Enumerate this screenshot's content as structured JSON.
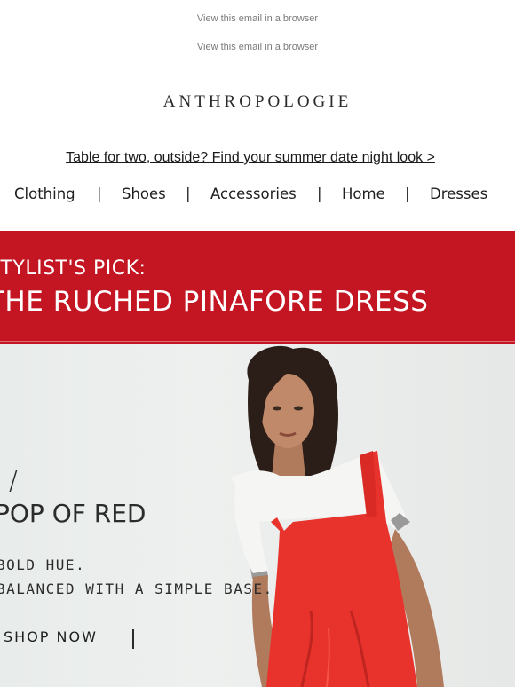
{
  "header": {
    "view_in_browser_1": "View this email in a browser",
    "view_in_browser_2": "View this email in a browser",
    "logo": "ANTHROPOLOGIE",
    "promo_link": "Table for two, outside? Find your summer date night look >"
  },
  "nav": {
    "items": [
      "Clothing",
      "Shoes",
      "Accessories",
      "Home",
      "Dresses"
    ],
    "separator": "|"
  },
  "banner": {
    "kicker": "STYLIST'S PICK:",
    "title": "THE RUCHED PINAFORE DRESS",
    "background": "#c41622"
  },
  "hero": {
    "slash": "/",
    "heading": "POP OF RED",
    "line1": "BOLD HUE.",
    "line2": "BALANCED WITH A SIMPLE BASE.",
    "cta": "SHOP NOW",
    "dress_color": "#e8322c"
  }
}
